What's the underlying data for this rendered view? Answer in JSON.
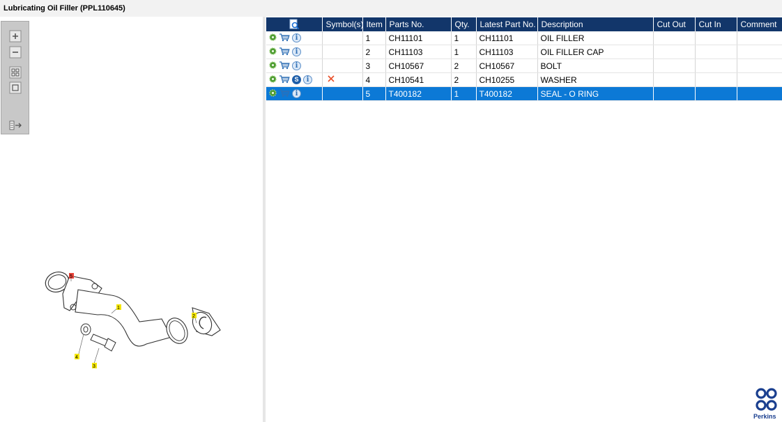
{
  "window": {
    "title": "Lubricating Oil Filler (PPL110645)"
  },
  "toolbar": {
    "buttons": [
      {
        "name": "zoom-in",
        "icon": "plus-icon"
      },
      {
        "name": "zoom-out",
        "icon": "minus-icon"
      },
      {
        "name": "fit-view",
        "icon": "grid-icon"
      },
      {
        "name": "actual-size",
        "icon": "square-icon"
      },
      {
        "name": "toggle-pane",
        "icon": "panel-arrow-icon"
      }
    ]
  },
  "diagram": {
    "callouts": [
      "5",
      "1",
      "2",
      "4",
      "3"
    ],
    "callout_colors": {
      "highlight": "#e8443a",
      "default": "#f4e600"
    }
  },
  "grid": {
    "headers": [
      "",
      "Symbol(s)",
      "Item",
      "Parts No.",
      "Qty.",
      "Latest Part No.",
      "Description",
      "Cut Out",
      "Cut In",
      "Comment"
    ],
    "rows": [
      {
        "icons": [
          "gear-icon",
          "cart-icon",
          "info-icon"
        ],
        "symbol": "",
        "item": "1",
        "part_no": "CH11101",
        "qty": "1",
        "latest_part_no": "CH11101",
        "description": "OIL FILLER",
        "cut_out": "",
        "cut_in": "",
        "comment": "",
        "selected": false
      },
      {
        "icons": [
          "gear-icon",
          "cart-icon",
          "info-icon"
        ],
        "symbol": "",
        "item": "2",
        "part_no": "CH11103",
        "qty": "1",
        "latest_part_no": "CH11103",
        "description": "OIL FILLER CAP",
        "cut_out": "",
        "cut_in": "",
        "comment": "",
        "selected": false
      },
      {
        "icons": [
          "gear-icon",
          "cart-icon",
          "info-icon"
        ],
        "symbol": "",
        "item": "3",
        "part_no": "CH10567",
        "qty": "2",
        "latest_part_no": "CH10567",
        "description": "BOLT",
        "cut_out": "",
        "cut_in": "",
        "comment": "",
        "selected": false
      },
      {
        "icons": [
          "gear-icon",
          "cart-icon",
          "supersession-icon",
          "info-icon"
        ],
        "supersession_label": "S",
        "symbol": "x-mark-icon",
        "item": "4",
        "part_no": "CH10541",
        "qty": "2",
        "latest_part_no": "CH10255",
        "description": "WASHER",
        "cut_out": "",
        "cut_in": "",
        "comment": "",
        "selected": false
      },
      {
        "icons": [
          "gear-icon",
          "cart-icon",
          "info-icon"
        ],
        "symbol": "",
        "item": "5",
        "part_no": "T400182",
        "qty": "1",
        "latest_part_no": "T400182",
        "description": "SEAL - O RING",
        "cut_out": "",
        "cut_in": "",
        "comment": "",
        "selected": true
      }
    ]
  },
  "colors": {
    "header_bg": "#12366a",
    "selected_row": "#0c79d6",
    "symbol_x": "#e8502a",
    "logo": "#1a3f8f"
  },
  "brand": {
    "name": "Perkins"
  }
}
